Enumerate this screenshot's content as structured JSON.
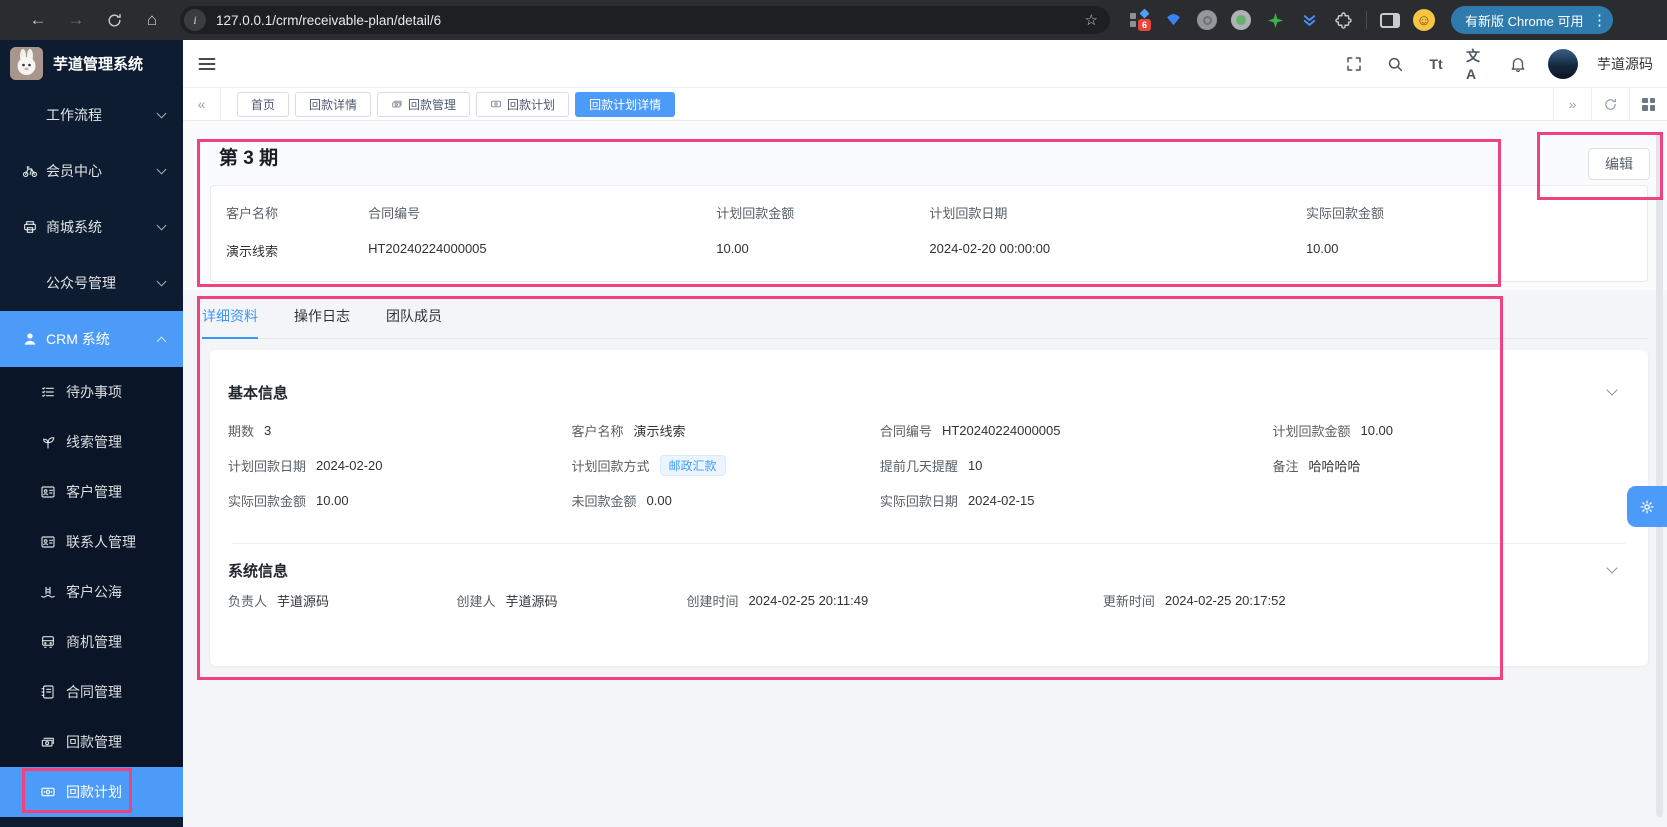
{
  "colors": {
    "accent": "#4c9bf8",
    "annotation": "#f1417e",
    "tag_bg": "#ecf5ff",
    "tag_text": "#409eff",
    "sidebar_bg": "#0d1c31"
  },
  "glyphs": {
    "back": "←",
    "forward": "→",
    "home": "⌂",
    "star": "☆",
    "info": "i",
    "more": "⋮",
    "chevrons_left": "«",
    "chevrons_right": "»",
    "smiley": "☺",
    "font_icon": "Tt",
    "lang_icon": "文A"
  },
  "browser": {
    "url": "127.0.0.1/crm/receivable-plan/detail/6",
    "extension_badge": "6",
    "update_button": "有新版 Chrome 可用"
  },
  "app": {
    "logo_title": "芋道管理系统",
    "username": "芋道源码"
  },
  "sidebar": {
    "parents": [
      {
        "label": "工作流程"
      },
      {
        "label": "会员中心"
      },
      {
        "label": "商城系统"
      },
      {
        "label": "公众号管理"
      },
      {
        "label": "CRM 系统",
        "active": true
      }
    ],
    "subitems": [
      {
        "label": "待办事项"
      },
      {
        "label": "线索管理"
      },
      {
        "label": "客户管理"
      },
      {
        "label": "联系人管理"
      },
      {
        "label": "客户公海"
      },
      {
        "label": "商机管理"
      },
      {
        "label": "合同管理"
      },
      {
        "label": "回款管理"
      },
      {
        "label": "回款计划",
        "active": true
      }
    ]
  },
  "tabbar": {
    "tabs": [
      {
        "label": "首页"
      },
      {
        "label": "回款详情"
      },
      {
        "label": "回款管理",
        "icon": "money-stack-icon"
      },
      {
        "label": "回款计划",
        "icon": "banknote-icon"
      },
      {
        "label": "回款计划详情",
        "active": true
      }
    ]
  },
  "detail": {
    "title": "第 3 期",
    "edit_button": "编辑",
    "summary": [
      {
        "label": "客户名称",
        "value": "演示线索"
      },
      {
        "label": "合同编号",
        "value": "HT20240224000005"
      },
      {
        "label": "计划回款金额",
        "value": "10.00"
      },
      {
        "label": "计划回款日期",
        "value": "2024-02-20 00:00:00"
      },
      {
        "label": "实际回款金额",
        "value": "10.00"
      }
    ],
    "tabs": [
      {
        "label": "详细资料",
        "active": true
      },
      {
        "label": "操作日志"
      },
      {
        "label": "团队成员"
      }
    ],
    "basic_info": {
      "title": "基本信息",
      "fields": [
        {
          "label": "期数",
          "value": "3"
        },
        {
          "label": "客户名称",
          "value": "演示线索"
        },
        {
          "label": "合同编号",
          "value": "HT20240224000005"
        },
        {
          "label": "计划回款金额",
          "value": "10.00"
        },
        {
          "label": "计划回款日期",
          "value": "2024-02-20"
        },
        {
          "label": "计划回款方式",
          "value": "邮政汇款",
          "tag": true
        },
        {
          "label": "提前几天提醒",
          "value": "10"
        },
        {
          "label": "备注",
          "value": "哈哈哈哈"
        },
        {
          "label": "实际回款金额",
          "value": "10.00"
        },
        {
          "label": "未回款金额",
          "value": "0.00"
        },
        {
          "label": "实际回款日期",
          "value": "2024-02-15"
        }
      ]
    },
    "system_info": {
      "title": "系统信息",
      "fields": [
        {
          "label": "负责人",
          "value": "芋道源码"
        },
        {
          "label": "创建人",
          "value": "芋道源码"
        },
        {
          "label": "创建时间",
          "value": "2024-02-25 20:11:49"
        },
        {
          "label": "更新时间",
          "value": "2024-02-25 20:17:52"
        }
      ]
    }
  }
}
